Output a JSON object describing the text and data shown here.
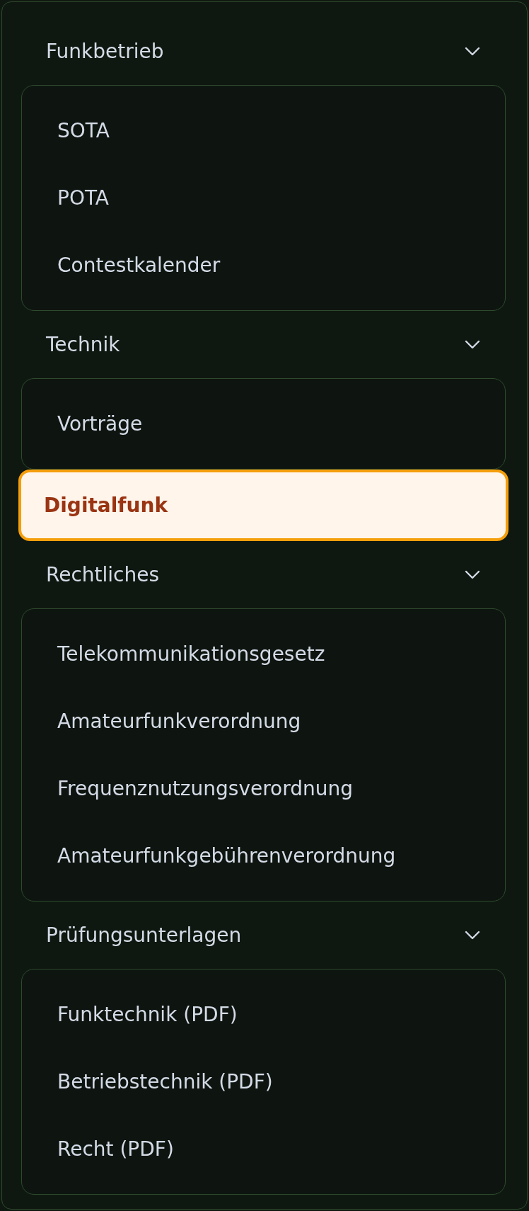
{
  "nav": [
    {
      "kind": "group",
      "label": "Funkbetrieb",
      "expanded": true,
      "children": [
        {
          "label": "SOTA",
          "selected": false
        },
        {
          "label": "POTA",
          "selected": false
        },
        {
          "label": "Contestkalender",
          "selected": false
        }
      ]
    },
    {
      "kind": "group",
      "label": "Technik",
      "expanded": true,
      "children": [
        {
          "label": "Vorträge",
          "selected": false
        }
      ]
    },
    {
      "kind": "link",
      "label": "Digitalfunk",
      "selected": true
    },
    {
      "kind": "group",
      "label": "Rechtliches",
      "expanded": true,
      "children": [
        {
          "label": "Telekommunikationsgesetz",
          "selected": false
        },
        {
          "label": "Amateurfunkverordnung",
          "selected": false
        },
        {
          "label": "Frequenznutzungsverordnung",
          "selected": false
        },
        {
          "label": "Amateurfunkgebührenverordnung",
          "selected": false
        }
      ]
    },
    {
      "kind": "group",
      "label": "Prüfungsunterlagen",
      "expanded": true,
      "children": [
        {
          "label": "Funktechnik (PDF)",
          "selected": false
        },
        {
          "label": "Betriebstechnik (PDF)",
          "selected": false
        },
        {
          "label": "Recht (PDF)",
          "selected": false
        }
      ]
    }
  ]
}
